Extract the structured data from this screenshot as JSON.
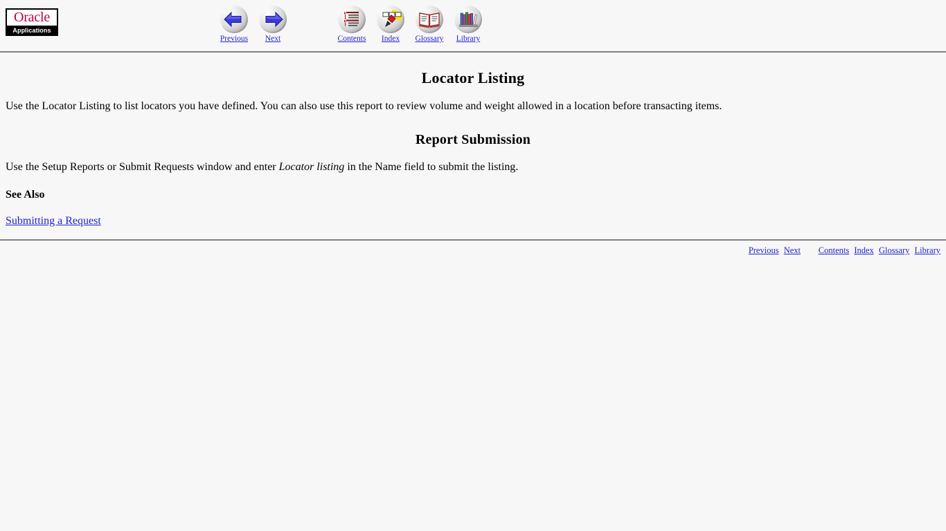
{
  "page": {
    "background_color": "#f7f7f7",
    "link_color": "#2222cc",
    "rule_color": "#808080"
  },
  "logo": {
    "name": "oracle-applications-logo",
    "brand": "Oracle",
    "product": "Applications",
    "brand_color": "#b9003c"
  },
  "topnav": {
    "prevnext": [
      {
        "icon": "left-arrow-icon",
        "label": "Previous"
      },
      {
        "icon": "right-arrow-icon",
        "label": "Next"
      }
    ],
    "books": [
      {
        "icon": "contents-list-icon",
        "label": "Contents"
      },
      {
        "icon": "index-highlighter-icon",
        "label": "Index"
      },
      {
        "icon": "glossary-open-book-icon",
        "label": "Glossary"
      },
      {
        "icon": "library-bookshelf-icon",
        "label": "Library"
      }
    ]
  },
  "main": {
    "title": "Locator Listing",
    "intro": "Use the Locator Listing to list locators you have defined. You can also use this report to review volume and weight allowed in a location before transacting items.",
    "section_title": "Report Submission",
    "submission_prefix": "Use the Setup Reports or Submit Requests window and enter ",
    "submission_emphasis": "Locator listing",
    "submission_suffix": " in the Name field to submit the listing.",
    "see_also_heading": "See Also",
    "see_also_link": "Submitting a Request"
  },
  "footer": {
    "prevnext": [
      "Previous",
      "Next"
    ],
    "books": [
      "Contents",
      "Index",
      "Glossary",
      "Library"
    ]
  }
}
